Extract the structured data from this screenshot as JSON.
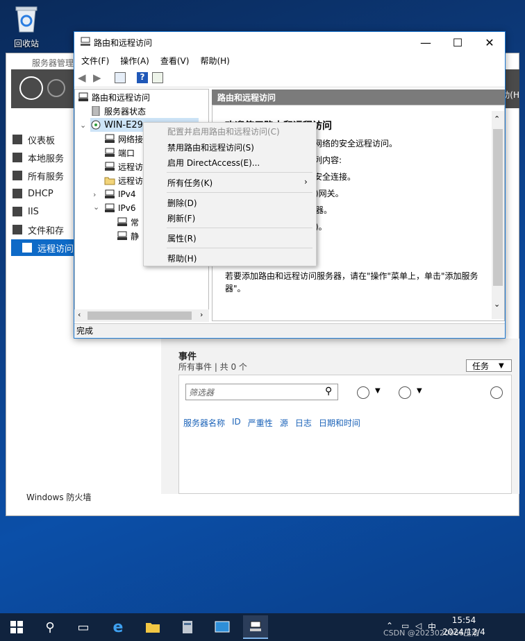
{
  "desktop": {
    "recycle_bin_label": "回收站"
  },
  "server_manager": {
    "title": "服务器管理",
    "sidebar": [
      {
        "label": "仪表板"
      },
      {
        "label": "本地服务"
      },
      {
        "label": "所有服务"
      },
      {
        "label": "DHCP"
      },
      {
        "label": "IIS"
      },
      {
        "label": "文件和存"
      },
      {
        "label": "远程访问"
      }
    ],
    "right_edge_text": "助(H",
    "events": {
      "title": "事件",
      "subtitle": "所有事件 | 共 0 个",
      "task_button": "任务",
      "filter_placeholder": "筛选器",
      "columns": [
        "服务器名称",
        "ID",
        "严重性",
        "源",
        "日志",
        "日期和时间"
      ]
    },
    "windows_firewall": "Windows 防火墙"
  },
  "rras": {
    "title": "路由和远程访问",
    "menu": [
      "文件(F)",
      "操作(A)",
      "查看(V)",
      "帮助(H)"
    ],
    "tree": {
      "root": "路由和远程访问",
      "server_status": "服务器状态",
      "server": "WIN-E29",
      "children": [
        "网络接",
        "端口",
        "远程访",
        "远程访"
      ],
      "ipv4": "IPv4",
      "ipv6": "IPv6",
      "ipv6_children": [
        "常",
        "静"
      ]
    },
    "pane": {
      "header": "路由和远程访问",
      "heading": "欢迎使用路由和远程访问",
      "lines": [
        "用网络的安全远程访问。",
        "下列内容:",
        "的安全连接。",
        ")网关。",
        "器。",
        ")。"
      ],
      "footer": "若要添加路由和远程访问服务器，请在\"操作\"菜单上，单击\"添加服务器\"。"
    },
    "status": "完成"
  },
  "context_menu": {
    "items": [
      {
        "label": "配置并启用路由和远程访问(C)",
        "disabled": true
      },
      {
        "label": "禁用路由和远程访问(S)",
        "disabled": false
      },
      {
        "label": "启用 DirectAccess(E)...",
        "disabled": false
      },
      {
        "label": "所有任务(K)",
        "disabled": false,
        "submenu": true
      },
      {
        "label": "删除(D)",
        "disabled": false
      },
      {
        "label": "刷新(F)",
        "disabled": false
      },
      {
        "label": "属性(R)",
        "disabled": false
      },
      {
        "label": "帮助(H)",
        "disabled": false
      }
    ]
  },
  "taskbar": {
    "time": "15:54",
    "date": "2024/12/4",
    "ime": "中",
    "watermark": "CSDN @2023020966王浩"
  }
}
